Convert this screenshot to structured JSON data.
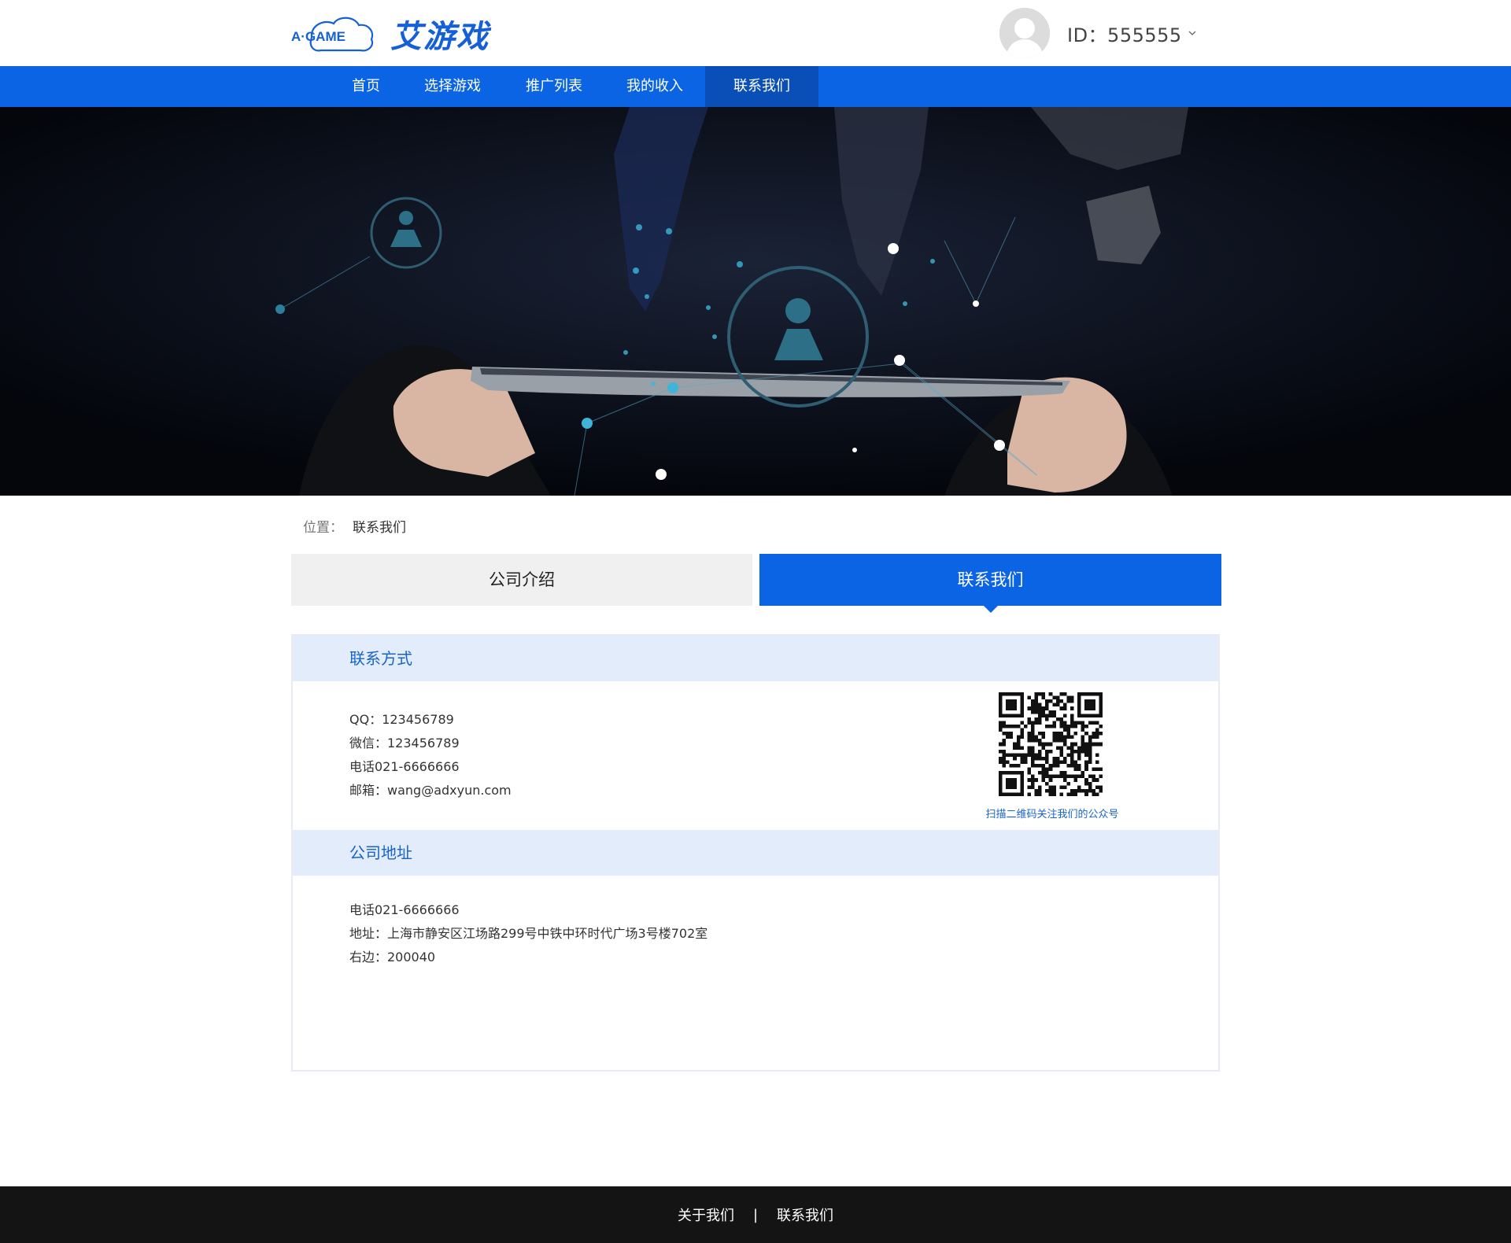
{
  "brand": {
    "logo_text": "A·GAME",
    "name_cn": "艾游戏",
    "color": "#1560d6"
  },
  "user": {
    "id_label": "ID：555555"
  },
  "nav": {
    "items": [
      {
        "label": "首页"
      },
      {
        "label": "选择游戏"
      },
      {
        "label": "推广列表"
      },
      {
        "label": "我的收入"
      },
      {
        "label": "联系我们",
        "active": true
      }
    ],
    "bg_color": "#0a64e3"
  },
  "breadcrumb": {
    "prefix": "位置：",
    "current": "联系我们"
  },
  "tabs": [
    {
      "label": "公司介绍",
      "active": false
    },
    {
      "label": "联系我们",
      "active": true
    }
  ],
  "contact": {
    "title": "联系方式",
    "lines": [
      "QQ：123456789",
      "微信：123456789",
      "电话021-6666666",
      "邮箱：wang@adxyun.com"
    ],
    "qr_caption": "扫描二维码关注我们的公众号"
  },
  "address": {
    "title": "公司地址",
    "lines": [
      "电话021-6666666",
      "地址：上海市静安区江场路299号中铁中环时代广场3号楼702室",
      "右边：200040"
    ]
  },
  "footer": {
    "links": [
      {
        "label": "关于我们"
      },
      {
        "label": "联系我们"
      }
    ],
    "separator": "|"
  }
}
